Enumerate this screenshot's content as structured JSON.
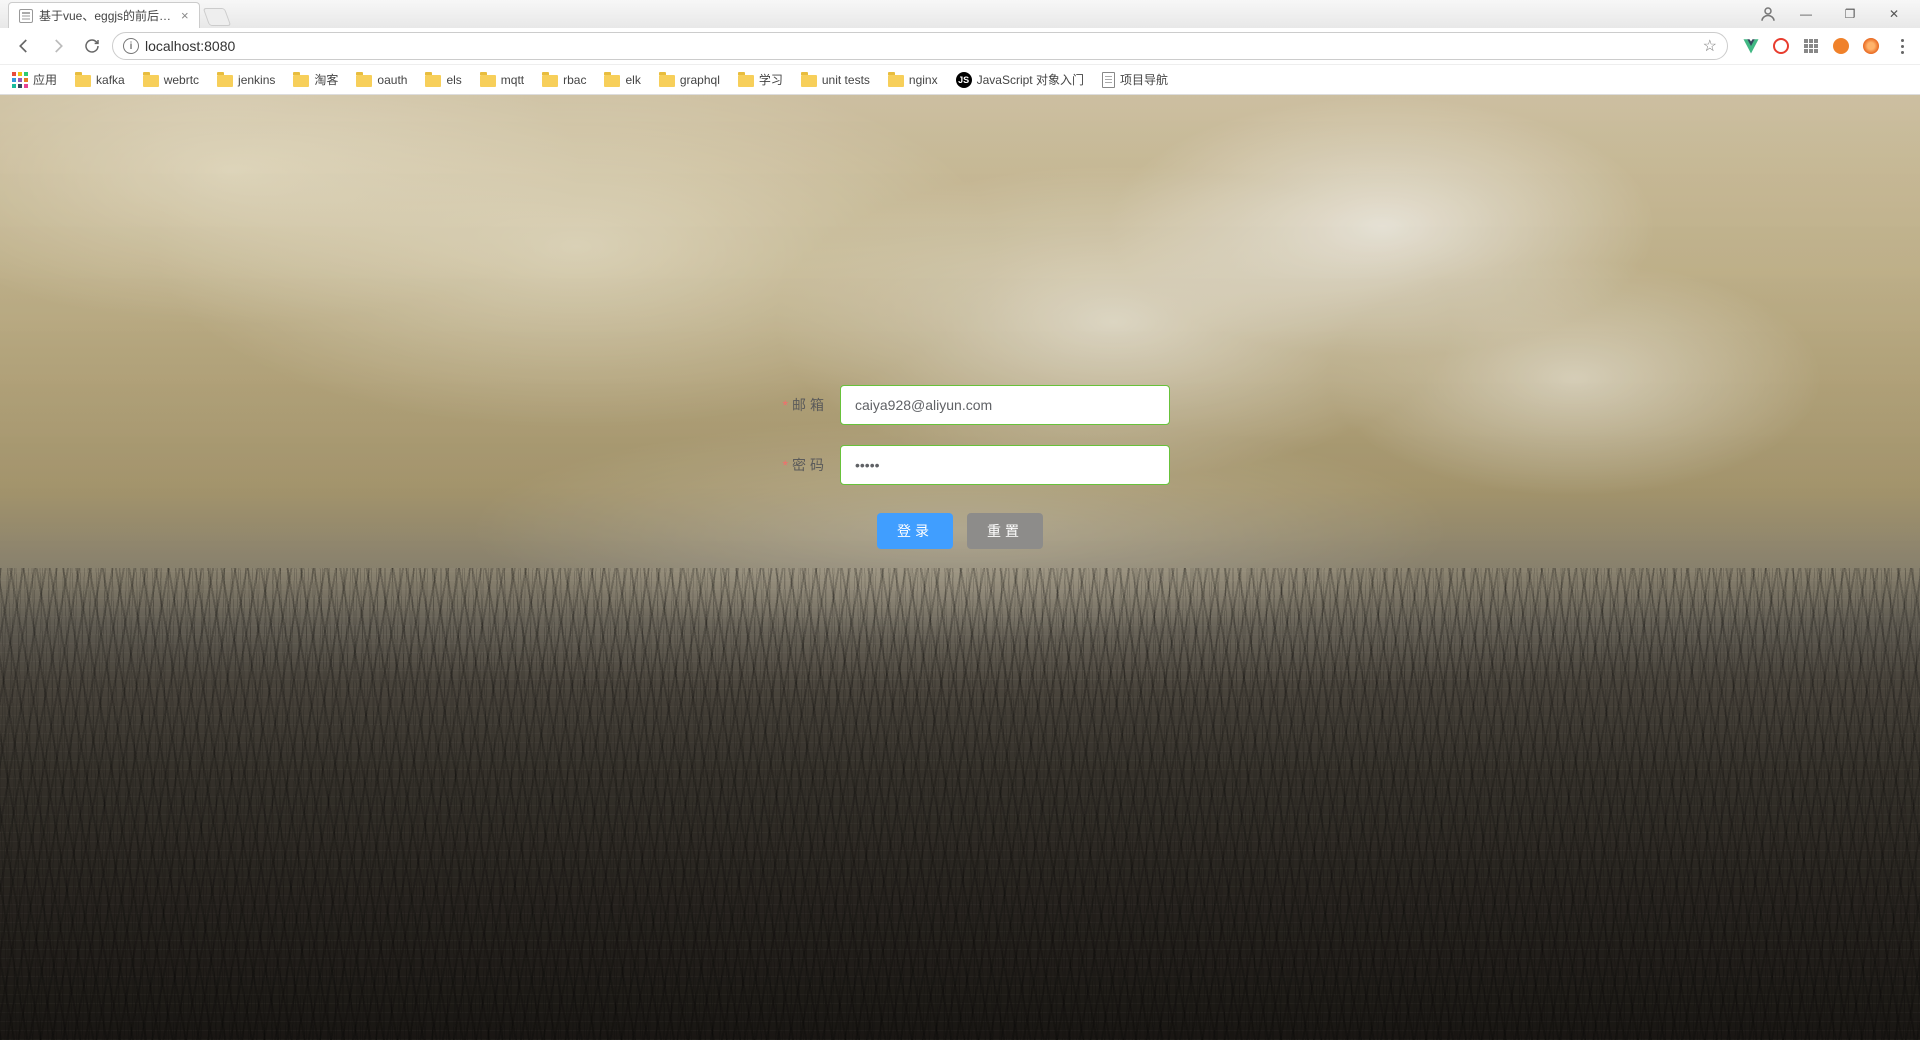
{
  "browser": {
    "tab_title": "基于vue、eggjs的前后…",
    "url": "localhost:8080",
    "window_controls": {
      "minimize": "—",
      "maximize": "❐",
      "close": "✕"
    }
  },
  "bookmarks": {
    "apps_label": "应用",
    "items": [
      {
        "type": "folder",
        "label": "kafka"
      },
      {
        "type": "folder",
        "label": "webrtc"
      },
      {
        "type": "folder",
        "label": "jenkins"
      },
      {
        "type": "folder",
        "label": "淘客"
      },
      {
        "type": "folder",
        "label": "oauth"
      },
      {
        "type": "folder",
        "label": "els"
      },
      {
        "type": "folder",
        "label": "mqtt"
      },
      {
        "type": "folder",
        "label": "rbac"
      },
      {
        "type": "folder",
        "label": "elk"
      },
      {
        "type": "folder",
        "label": "graphql"
      },
      {
        "type": "folder",
        "label": "学习"
      },
      {
        "type": "folder",
        "label": "unit tests"
      },
      {
        "type": "folder",
        "label": "nginx"
      },
      {
        "type": "js",
        "label": "JavaScript 对象入门"
      },
      {
        "type": "doc",
        "label": "项目导航"
      }
    ]
  },
  "login": {
    "email_label": "邮箱",
    "email_value": "caiya928@aliyun.com",
    "password_label": "密码",
    "password_value": "•••••",
    "login_button": "登录",
    "reset_button": "重置"
  }
}
